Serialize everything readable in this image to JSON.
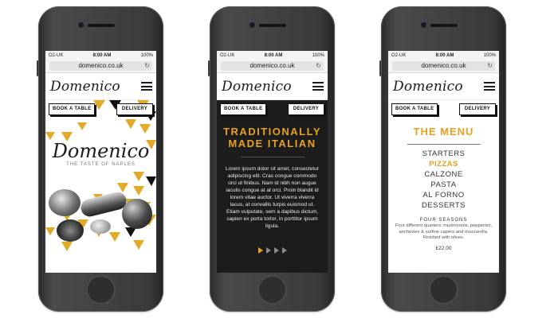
{
  "status": {
    "carrier": "O2-UK",
    "time": "8:00 AM",
    "battery": "100%"
  },
  "browser": {
    "url": "domenico.co.uk",
    "reload_icon": "reload-icon"
  },
  "brand": {
    "logo": "Domenico",
    "tagline": "THE TASTE OF NAPLES"
  },
  "nav": {
    "book_label": "BOOK A TABLE",
    "delivery_label": "DELIVERY",
    "menu_icon": "hamburger-icon"
  },
  "colors": {
    "accent": "#e8a020",
    "dark": "#1c1c1c",
    "phone": "#3a3a3c"
  },
  "about": {
    "title_line1": "TRADITIONALLY",
    "title_line2": "MADE ITALIAN",
    "body": "Lorem ipsum dolor sit amet, consectetur adipiscing elit. Cras congue commodo orci ut finibus. Nam id nibh non augue iaculis congue at at orci. Proin blandit id lorem vitae auctor. Ut viverra viverra lacus, at convallis turpis euismod ut. Etiam vulputate, sem a dapibus dictum, sapien ex porta tortor, in porttitor ipsum ligula.",
    "slides_total": 4,
    "slide_active": 1
  },
  "menu": {
    "title": "THE MENU",
    "items": [
      "STARTERS",
      "PIZZAS",
      "CALZONE",
      "PASTA",
      "AL FORNO",
      "DESSERTS"
    ],
    "active_item": "PIZZAS",
    "featured": {
      "name": "FOUR SEASONS",
      "description": "Four different quarters: mushrooms, pepperoni, anchovies & surfine capers and mozzarella. Finished with olives.",
      "price": "£22.00"
    }
  }
}
